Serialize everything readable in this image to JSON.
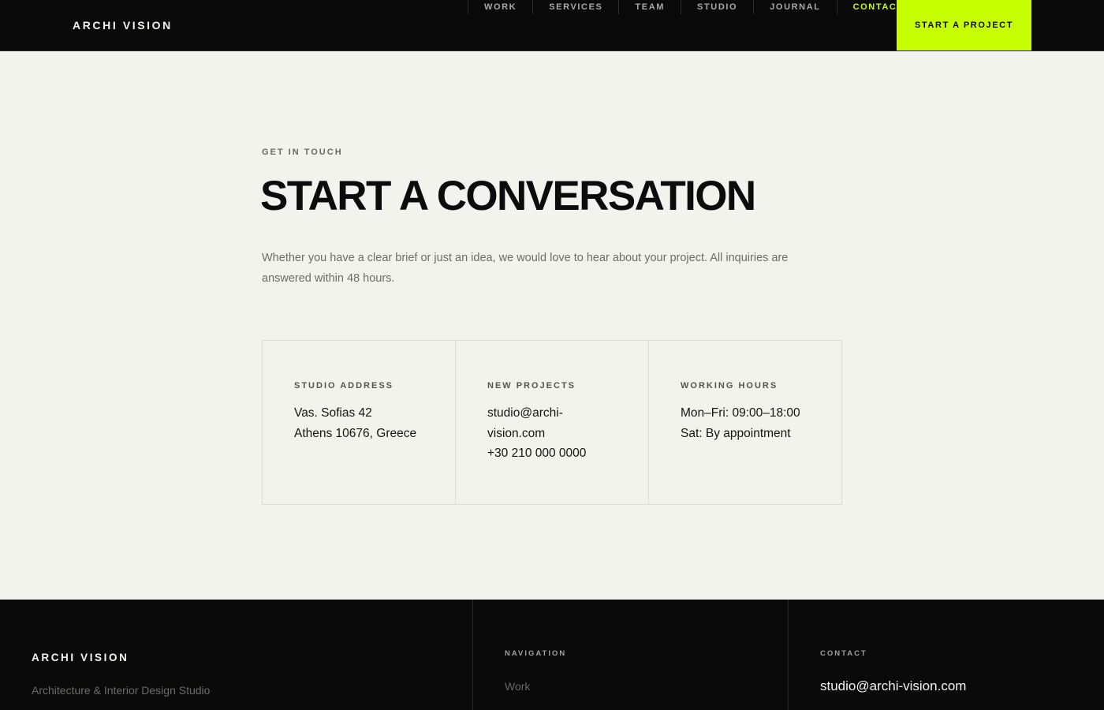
{
  "header": {
    "logo": "ARCHI VISION",
    "nav": [
      {
        "label": "WORK"
      },
      {
        "label": "SERVICES"
      },
      {
        "label": "TEAM"
      },
      {
        "label": "STUDIO"
      },
      {
        "label": "JOURNAL"
      },
      {
        "label": "CONTACT",
        "active": true
      }
    ],
    "cta": "START A PROJECT"
  },
  "main": {
    "eyebrow": "GET IN TOUCH",
    "title": "START A CONVERSATION",
    "lead": "Whether you have a clear brief or just an idea, we would love to hear about your project. All inquiries are answered within 48 hours.",
    "cards": [
      {
        "label": "STUDIO ADDRESS",
        "lines": [
          "Vas. Sofias 42",
          "Athens 10676, Greece"
        ]
      },
      {
        "label": "NEW PROJECTS",
        "lines": [
          "studio@archi-",
          "vision.com",
          "+30 210 000 0000"
        ]
      },
      {
        "label": "WORKING HOURS",
        "lines": [
          "Mon–Fri: 09:00–18:00",
          "Sat: By appointment"
        ]
      }
    ]
  },
  "footer": {
    "logo": "ARCHI VISION",
    "tagline": "Architecture & Interior Design Studio",
    "navigation_heading": "NAVIGATION",
    "navigation_first_link": "Work",
    "contact_heading": "CONTACT",
    "contact_email": "studio@archi-vision.com"
  },
  "colors": {
    "accent": "#c8ff00",
    "dark": "#0a0a0a",
    "background": "#f3f3ee"
  }
}
